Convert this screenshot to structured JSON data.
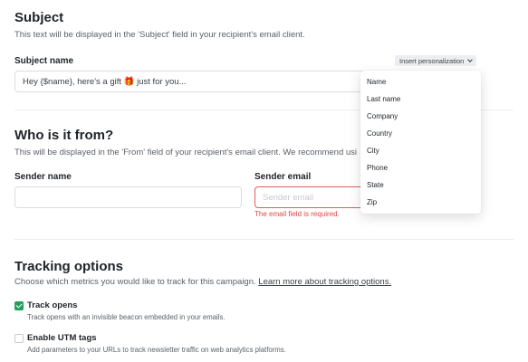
{
  "subject": {
    "title": "Subject",
    "description": "This text will be displayed in the 'Subject' field in your recipient's email client.",
    "field_label": "Subject name",
    "field_value": "Hey {$name}, here's a gift 🎁 just for you...",
    "personalize_label": "Insert personalization",
    "dropdown_items": [
      "Name",
      "Last name",
      "Company",
      "Country",
      "City",
      "Phone",
      "State",
      "Zip"
    ]
  },
  "from": {
    "title": "Who is it from?",
    "description": "This will be displayed in the 'From' field of your recipient's email client. We recommend usi",
    "sender_name_label": "Sender name",
    "sender_name_value": "",
    "sender_email_label": "Sender email",
    "sender_email_placeholder": "Sender email",
    "sender_email_error": "The email field is required."
  },
  "tracking": {
    "title": "Tracking options",
    "description_prefix": "Choose which metrics you would like to track for this campaign. ",
    "description_link": "Learn more about tracking options.",
    "options": [
      {
        "label": "Track opens",
        "description": "Track opens with an invisible beacon embedded in your emails.",
        "checked": true
      },
      {
        "label": "Enable UTM tags",
        "description": "Add parameters to your URLs to track newsletter traffic on web analytics platforms.",
        "checked": false
      }
    ]
  },
  "colors": {
    "accent_green": "#22a05b",
    "error_red": "#e04848"
  }
}
